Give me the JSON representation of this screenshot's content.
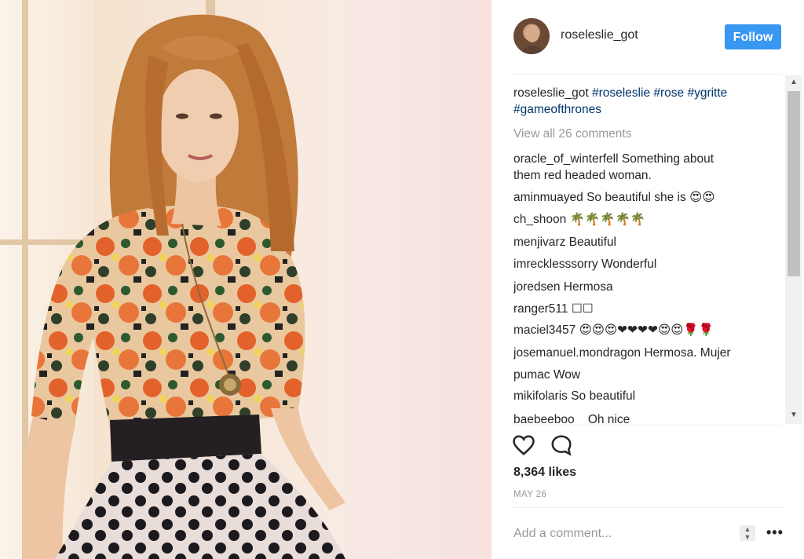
{
  "photo": {
    "alt": "Photo of a red-haired woman in a floral top and polka-dot skirt"
  },
  "header": {
    "username": "roseleslie_got",
    "follow_label": "Follow"
  },
  "caption": {
    "username": "roseleslie_got",
    "tags_line1": "#roseleslie #rose #ygritte",
    "tags_line2": "#gameofthrones"
  },
  "view_all_label": "View all 26 comments",
  "comments": [
    {
      "user": "oracle_of_winterfell",
      "text": "Something about",
      "text2": "them red headed woman."
    },
    {
      "user": "aminmuayed",
      "text": "So beautiful she is 😍😍"
    },
    {
      "user": "ch_shoon",
      "text": "🌴🌴🌴🌴🌴"
    },
    {
      "user": "menjivarz",
      "text": "Beautiful"
    },
    {
      "user": "imrecklesssorry",
      "text": "Wonderful"
    },
    {
      "user": "joredsen",
      "text": "Hermosa"
    },
    {
      "user": "ranger511",
      "text": "☐☐"
    },
    {
      "user": "maciel3457",
      "text": "😍😍😍❤❤❤❤😍😍🌹🌹"
    },
    {
      "user": "josemanuel.mondragon",
      "text": "Hermosa. Mujer"
    },
    {
      "user": "pumac",
      "text": "Wow"
    },
    {
      "user": "mikifolaris",
      "text": "So beautiful"
    },
    {
      "user": "baebeeboo",
      "text": "   Oh nice"
    }
  ],
  "likes": "8,364 likes",
  "date": "MAY 26",
  "add_comment_placeholder": "Add a comment...",
  "more_label": "•••",
  "colors": {
    "follow_bg": "#3897f0",
    "tag": "#003569",
    "muted": "#999999"
  }
}
